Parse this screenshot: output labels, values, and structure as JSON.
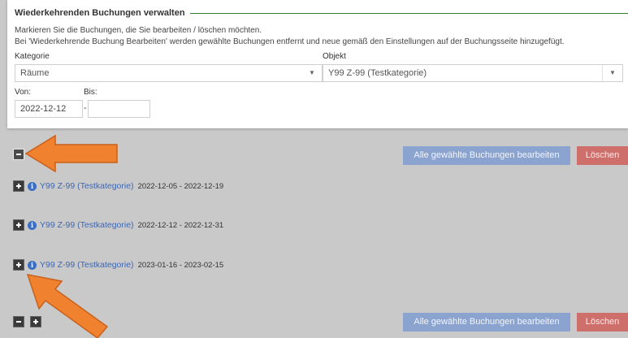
{
  "panel": {
    "title": "Wiederkehrenden Buchungen verwalten",
    "info_line1": "Markieren Sie die Buchungen, die Sie bearbeiten / löschen möchten.",
    "info_line2": "Bei 'Wiederkehrende Buchung Bearbeiten' werden gewählte Buchungen entfernt und neue gemäß den Einstellungen auf der Buchungsseite hinzugefügt.",
    "kategorie_label": "Kategorie",
    "kategorie_value": "Räume",
    "objekt_label": "Objekt",
    "objekt_value": "Y99 Z-99 (Testkategorie)",
    "von_label": "Von:",
    "von_value": "2022-12-12",
    "bis_label": "Bis:",
    "bis_value": "",
    "dash": "-"
  },
  "actions": {
    "edit_all_label": "Alle gewählte Buchungen bearbeiten",
    "delete_label": "Löschen"
  },
  "bookings": [
    {
      "name": "Y99 Z-99 (Testkategorie)",
      "range": "2022-12-05 - 2022-12-19"
    },
    {
      "name": "Y99 Z-99 (Testkategorie)",
      "range": "2022-12-12 - 2022-12-31"
    },
    {
      "name": "Y99 Z-99 (Testkategorie)",
      "range": "2023-01-16 - 2023-02-15"
    }
  ],
  "icons": {
    "collapse": "minus-square-icon",
    "expand": "plus-square-icon",
    "info": "info-circle-icon",
    "caret": "caret-down-icon",
    "annotation": "orange-arrow"
  },
  "colors": {
    "accent_line": "#2e7d32",
    "primary_button": "#8ba3cf",
    "danger_button": "#cf6f6b",
    "link": "#3f66b1",
    "annotation_arrow": "#f0822f"
  }
}
